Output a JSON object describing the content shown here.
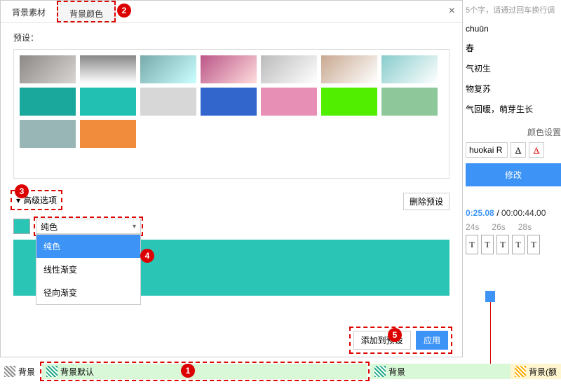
{
  "tabs": {
    "material": "背景素材",
    "color": "背景颜色"
  },
  "close": "×",
  "preset_label": "预设：",
  "swatches": [
    [
      "linear-gradient(135deg,#8b8886,#d9d6d4)",
      "linear-gradient(#888,#fff)",
      "linear-gradient(135deg,#7aa,#cff)",
      "linear-gradient(135deg,#b58,#fdd)",
      "linear-gradient(135deg,#bbb,#fff)",
      "linear-gradient(135deg,#c8a890,#fff)",
      "linear-gradient(135deg,#8cc,#fff)"
    ],
    [
      "#1aa89c",
      "#21c0b3",
      "#d7d7d7",
      "#3366cc",
      "#e88fb5",
      "#51ee00",
      "#8ec89a"
    ],
    [
      "#99b6b6",
      "#f08c3c"
    ]
  ],
  "advanced": "高级选项",
  "delete_preset": "删除预设",
  "select": {
    "value": "纯色",
    "options": [
      "纯色",
      "线性渐变",
      "径向渐变"
    ]
  },
  "actions": {
    "add_preset": "添加到预设",
    "apply": "应用"
  },
  "right": {
    "hint": "5个字，请通过回车换行调",
    "lines": [
      "chuūn",
      "春",
      "气初生",
      "物复苏",
      "气回暖，萌芽生长"
    ],
    "color_setting_label": "颜色设置",
    "font": "huokai R",
    "apply": "修改",
    "time1": "0:25.08",
    "time2": "00:00:44.00",
    "ruler": [
      "24s",
      "26s",
      "28s"
    ]
  },
  "footer": {
    "bg": "背景",
    "bg_default": "背景默认",
    "bg2": "背景",
    "bg_extra": "背景(额"
  }
}
